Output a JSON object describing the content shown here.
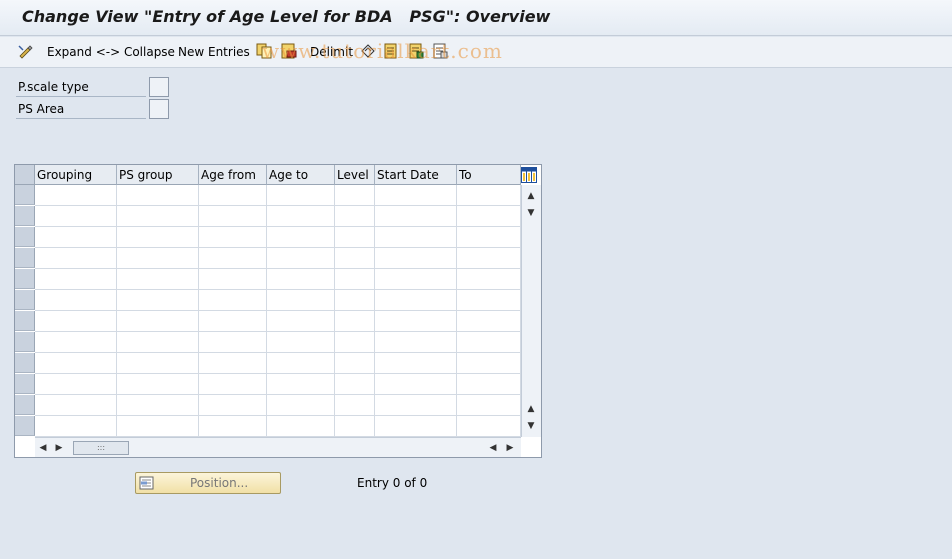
{
  "title": "Change View \"Entry of Age Level for BDA   PSG\": Overview",
  "toolbar": {
    "expand_collapse": "Expand <-> Collapse",
    "new_entries": "New Entries",
    "delimit": "Delimit"
  },
  "watermark": "www.tutorialkart.com",
  "fields": [
    {
      "label": "P.scale type",
      "value": ""
    },
    {
      "label": "PS Area",
      "value": ""
    }
  ],
  "table": {
    "columns": [
      "Grouping",
      "PS group",
      "Age from",
      "Age to",
      "Level",
      "Start Date",
      "To"
    ],
    "rows": []
  },
  "position_button": "Position...",
  "entry_info": "Entry 0 of 0"
}
